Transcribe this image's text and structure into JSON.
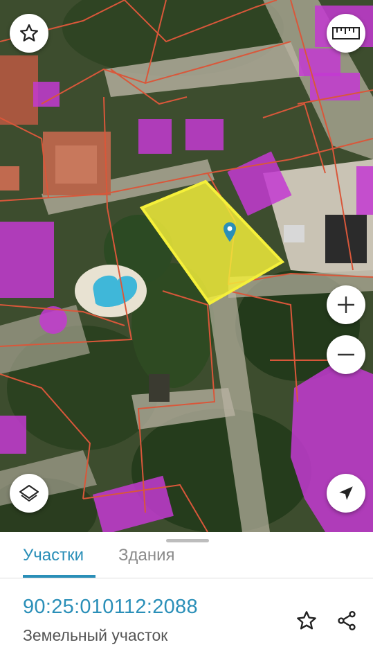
{
  "map": {
    "selected_parcel_color": "#f5f03a",
    "parcel_border_color": "#d9573a",
    "building_color": "#c33ad1",
    "controls": {
      "favorite": "star-outline-icon",
      "ruler": "ruler-icon",
      "zoom_in": "plus-icon",
      "zoom_out": "minus-icon",
      "layers": "layers-icon",
      "my_location": "navigation-arrow-icon"
    },
    "marker": "location-pin-icon"
  },
  "sheet": {
    "tabs": [
      {
        "label": "Участки",
        "active": true
      },
      {
        "label": "Здания",
        "active": false
      }
    ],
    "cadastral_number": "90:25:010112:2088",
    "object_type": "Земельный участок",
    "actions": {
      "favorite": "star-outline-icon",
      "share": "share-icon"
    }
  },
  "colors": {
    "accent": "#2a8fb8",
    "tab_inactive": "#8a8a8a",
    "subtitle": "#555555"
  }
}
